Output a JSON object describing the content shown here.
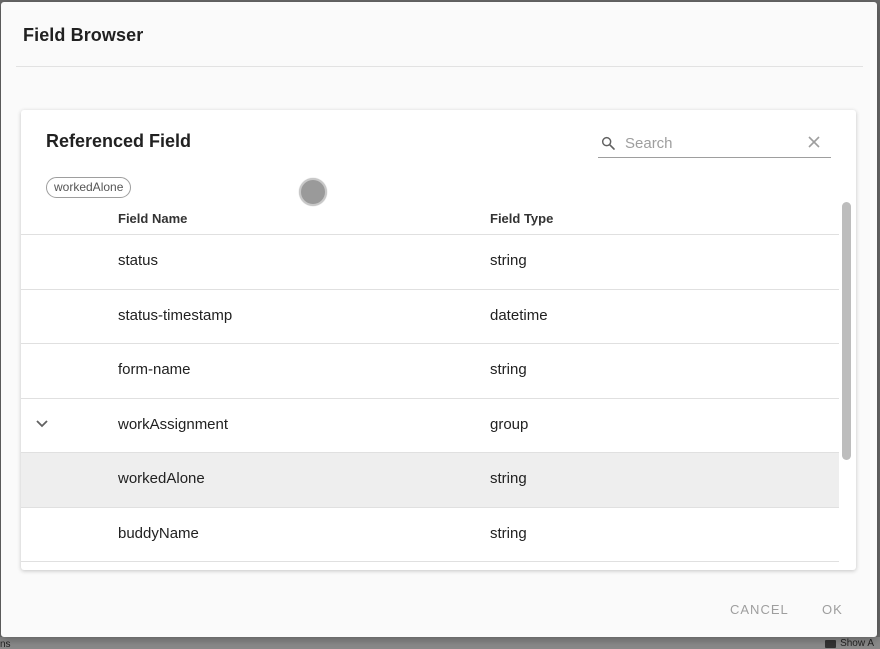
{
  "dialog": {
    "title": "Field Browser"
  },
  "panel": {
    "title": "Referenced Field",
    "search": {
      "placeholder": "Search",
      "value": ""
    },
    "chip": "workedAlone",
    "columns": {
      "name": "Field Name",
      "type": "Field Type"
    },
    "rows": [
      {
        "name": "status",
        "type": "string",
        "expandable": false,
        "selected": false
      },
      {
        "name": "status-timestamp",
        "type": "datetime",
        "expandable": false,
        "selected": false
      },
      {
        "name": "form-name",
        "type": "string",
        "expandable": false,
        "selected": false
      },
      {
        "name": "workAssignment",
        "type": "group",
        "expandable": true,
        "selected": false
      },
      {
        "name": "workedAlone",
        "type": "string",
        "expandable": false,
        "selected": true
      },
      {
        "name": "buddyName",
        "type": "string",
        "expandable": false,
        "selected": false
      }
    ]
  },
  "actions": {
    "cancel": "CANCEL",
    "ok": "OK"
  },
  "background": {
    "left_text": "ns",
    "right_text": "Show A"
  },
  "colors": {
    "selected_row": "#eeeeee",
    "button_text": "#9e9e9e"
  }
}
